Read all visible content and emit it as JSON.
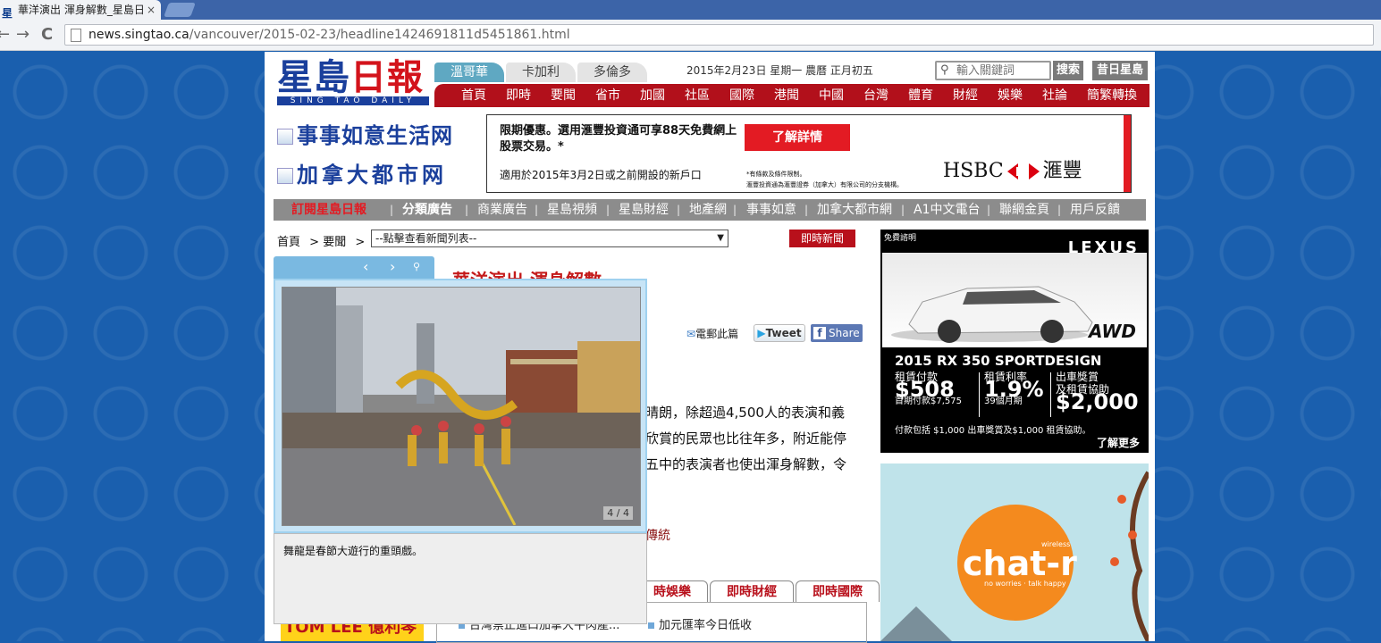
{
  "browser": {
    "tab_title": "華洋演出 渾身解數_星島日",
    "tab_close": "×",
    "favicon_text": "星",
    "url_host": "news.singtao.ca",
    "url_path": "/vancouver/2015-02-23/headline1424691811d5451861.html",
    "back_icon": "←",
    "forward_icon": "→",
    "reload_icon": "C"
  },
  "header": {
    "logo_main_blue": "星島",
    "logo_main_red": "日報",
    "logo_sub": "SING TAO DAILY",
    "city_tabs": [
      "溫哥華",
      "卡加利",
      "多倫多"
    ],
    "date": "2015年2月23日 星期一 農曆 正月初五",
    "search_placeholder": "輸入關鍵詞",
    "search_button": "搜索",
    "archive_button": "昔日星島"
  },
  "main_nav": [
    "首頁",
    "即時",
    "要聞",
    "省市",
    "加國",
    "社區",
    "國際",
    "港聞",
    "中國",
    "台灣",
    "體育",
    "財經",
    "娛樂",
    "社論",
    "簡繁轉換"
  ],
  "promo_links": [
    "事事如意生活网",
    "加拿大都市网"
  ],
  "hsbc_ad": {
    "headline": "限期優惠。選用滙豐投資通可享88天免費網上股票交易。*",
    "sub": "適用於2015年3月2日或之前開設的新戶口",
    "cta": "了解詳情",
    "fine1": "*有條款及條件限制。",
    "fine2": "滙豐投資通為滙豐證券（加拿大）有限公司的分支機構。",
    "brand_en": "HSBC",
    "brand_zh": "滙豐"
  },
  "sub_nav": [
    "訂閱星島日報",
    "分類廣告",
    "商業廣告",
    "星島視頻",
    "星島財經",
    "地產網",
    "事事如意",
    "加拿大都市網",
    "A1中文電台",
    "聯網金頁",
    "用戶反饋"
  ],
  "sub_nav_sep": "|",
  "breadcrumb": {
    "home": "首頁",
    "section": "要聞",
    "sep": ">",
    "select_value": "--點擊查看新聞列表--",
    "caret": "▼"
  },
  "breaking_button": "即時新聞",
  "article": {
    "headline": "華洋演出 渾身解數",
    "email": "電郵此篇",
    "tweet": "Tweet",
    "share": "Share",
    "fb_letter": "f",
    "body_lines": [
      "晴朗，除超過4,500人的表演和義",
      "欣賞的民眾也比往年多，附近能停",
      "五中的表演者也使出渾身解數，令"
    ],
    "tradition_link": "傳統"
  },
  "news_tabs": [
    "時娛樂",
    "即時財經",
    "即時國際"
  ],
  "news_list": [
    "台灣禁止進口加拿大牛肉產...",
    "加元匯率今日低收"
  ],
  "left_thumb_text": "TOM LEE 億利琴行",
  "gallery": {
    "prev_icon": "‹",
    "next_icon": "›",
    "zoom_icon": "🔍",
    "counter": "4 / 4",
    "caption": "舞龍是春節大遊行的重頭戲。"
  },
  "lexus_ad": {
    "sponsor": "免費諮明",
    "brand": "LEXUS",
    "awd": "AWD",
    "model": "2015 RX 350 SPORTDESIGN",
    "col1_label": "租賃付款",
    "col1_value": "$508",
    "col1_sub": "首期付款$7,575",
    "col2_label": "租賃利率",
    "col2_value": "1.9%",
    "col2_sub": "39個月期",
    "col3_label1": "出車獎賞",
    "col3_label2": "及租賃協助",
    "col3_value": "$2,000",
    "fine": "付款包括 $1,000 出車獎賞及$1,000 租賃協助。",
    "more": "了解更多"
  },
  "chatr_ad": {
    "logo": "chat-r",
    "wireless": "wireless",
    "tagline": "no worries · talk happy"
  },
  "colors": {
    "nav_red": "#b2101b",
    "logo_blue": "#1a3f9c",
    "accent_teal": "#5fa8c2",
    "page_bg": "#1a5fae"
  }
}
